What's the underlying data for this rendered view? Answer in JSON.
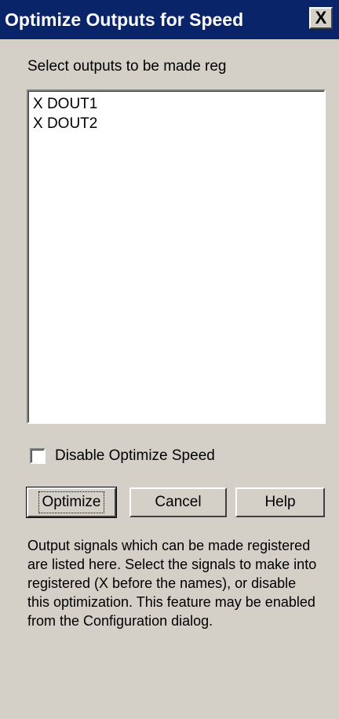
{
  "window": {
    "title": "Optimize Outputs for Speed",
    "close_label": "X"
  },
  "prompt": "Select outputs to be made reg",
  "outputs": [
    {
      "label": "X  DOUT1"
    },
    {
      "label": "X  DOUT2"
    }
  ],
  "disable_option": {
    "label": "Disable Optimize Speed",
    "checked": false
  },
  "buttons": {
    "optimize": "Optimize",
    "cancel": "Cancel",
    "help": "Help"
  },
  "help_text": "Output signals which can be made registered are listed here.  Select the signals to make into registered (X before the names), or disable this optimization.  This feature may be enabled from the Configuration dialog."
}
